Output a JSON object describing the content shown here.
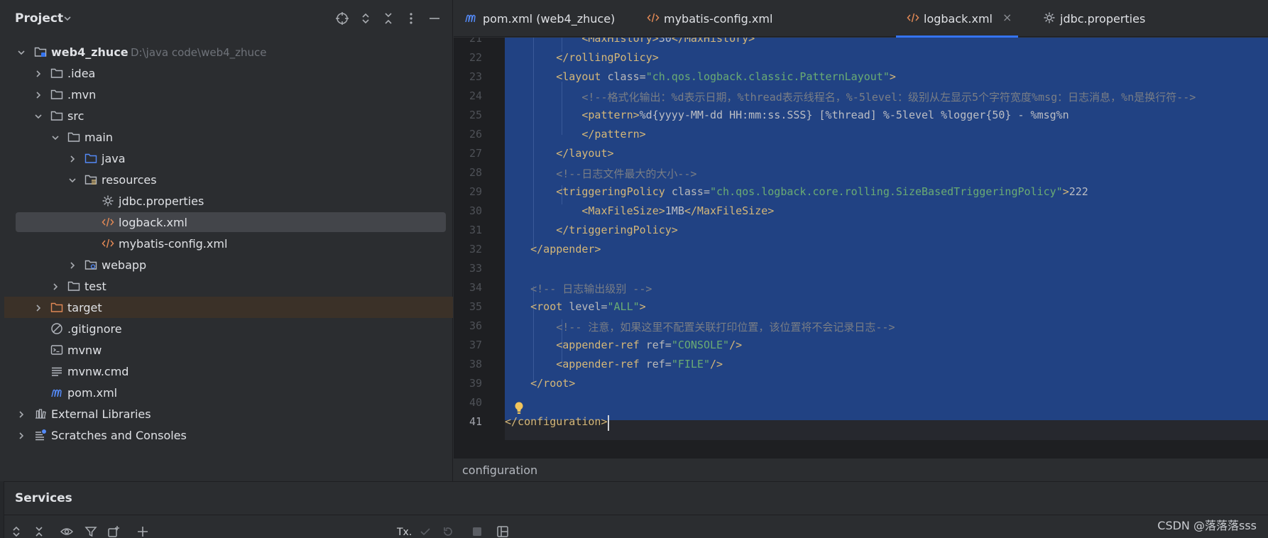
{
  "project_panel": {
    "title": "Project",
    "header_icons": [
      "locate-icon",
      "expand-all-icon",
      "collapse-all-icon",
      "more-icon",
      "minimize-icon"
    ],
    "tree": [
      {
        "label": "web4_zhuce",
        "path": "D:\\java code\\web4_zhuce",
        "icon": "module-folder-icon",
        "expanded": true,
        "depth": 0
      },
      {
        "label": ".idea",
        "icon": "folder-icon",
        "expanded": false,
        "depth": 1
      },
      {
        "label": ".mvn",
        "icon": "folder-icon",
        "expanded": false,
        "depth": 1
      },
      {
        "label": "src",
        "icon": "folder-icon",
        "expanded": true,
        "depth": 1
      },
      {
        "label": "main",
        "icon": "folder-icon",
        "expanded": true,
        "depth": 2
      },
      {
        "label": "java",
        "icon": "source-folder-icon",
        "expanded": false,
        "depth": 3
      },
      {
        "label": "resources",
        "icon": "resources-folder-icon",
        "expanded": true,
        "depth": 3
      },
      {
        "label": "jdbc.properties",
        "icon": "properties-file-icon",
        "depth": 4
      },
      {
        "label": "logback.xml",
        "icon": "xml-file-icon",
        "depth": 4,
        "selected": true
      },
      {
        "label": "mybatis-config.xml",
        "icon": "xml-file-icon",
        "depth": 4
      },
      {
        "label": "webapp",
        "icon": "web-folder-icon",
        "expanded": false,
        "depth": 3
      },
      {
        "label": "test",
        "icon": "folder-icon",
        "expanded": false,
        "depth": 2
      },
      {
        "label": "target",
        "icon": "excluded-folder-icon",
        "expanded": false,
        "depth": 1
      },
      {
        "label": ".gitignore",
        "icon": "gitignore-file-icon",
        "depth": 1
      },
      {
        "label": "mvnw",
        "icon": "shell-file-icon",
        "depth": 1
      },
      {
        "label": "mvnw.cmd",
        "icon": "text-file-icon",
        "depth": 1
      },
      {
        "label": "pom.xml",
        "icon": "maven-file-icon",
        "depth": 1
      },
      {
        "label": "External Libraries",
        "icon": "library-icon",
        "expanded": false,
        "depth": 0
      },
      {
        "label": "Scratches and Consoles",
        "icon": "scratches-icon",
        "expanded": false,
        "depth": 0
      }
    ]
  },
  "tabs": [
    {
      "label": "pom.xml (web4_zhuce)",
      "icon": "maven-file-icon"
    },
    {
      "label": "mybatis-config.xml",
      "icon": "xml-file-icon"
    },
    {
      "label": "logback.xml",
      "icon": "xml-file-icon",
      "active": true,
      "close": "×"
    },
    {
      "label": "jdbc.properties",
      "icon": "properties-file-icon"
    }
  ],
  "editor": {
    "line_numbers": [
      "21",
      "22",
      "23",
      "24",
      "25",
      "26",
      "27",
      "28",
      "29",
      "30",
      "31",
      "32",
      "33",
      "34",
      "35",
      "36",
      "37",
      "38",
      "39",
      "40",
      "41"
    ],
    "current_line": "41",
    "breadcrumb": "configuration"
  },
  "services": {
    "title": "Services",
    "tx_label": "Tx."
  },
  "watermark": "CSDN @落落落sss",
  "colors": {
    "selection": "#214283",
    "accent": "#3574f0",
    "tag": "#d5b778",
    "string": "#6aab73",
    "comment": "#7a7e85",
    "excluded_row": "#3b3128"
  }
}
